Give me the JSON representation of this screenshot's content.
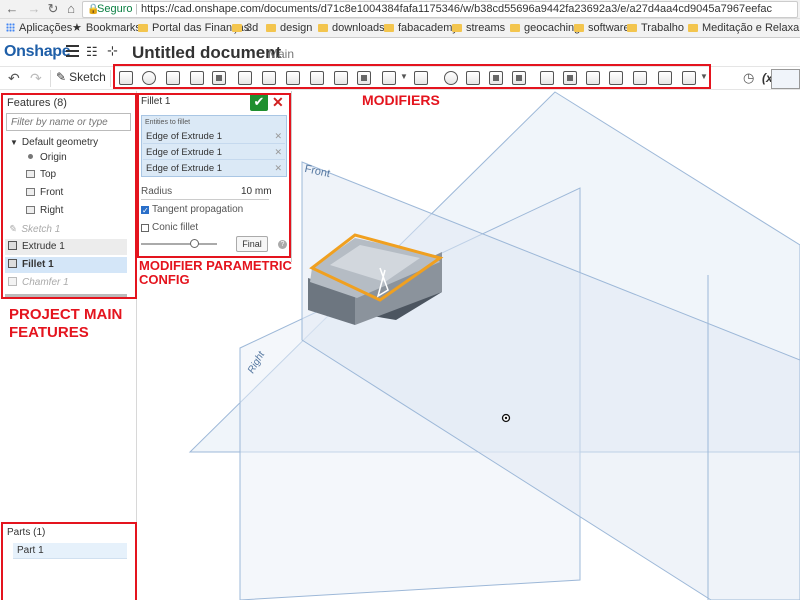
{
  "browser": {
    "secure_label": "Seguro",
    "url": "https://cad.onshape.com/documents/d71c8e1004384fafa1175346/w/b38cd55696a9442fa23692a3/e/a27d4aa4cd9045a7967eefac",
    "bookmarks": [
      "Aplicações",
      "Bookmarks",
      "Portal das Finanças",
      "3d",
      "design",
      "downloads",
      "fabacademy",
      "streams",
      "geocaching",
      "software",
      "Trabalho",
      "Meditação e Relaxam"
    ]
  },
  "app": {
    "logo": "Onshape",
    "document_title": "Untitled document",
    "workspace": "Main"
  },
  "toolbar": {
    "sketch_label": "Sketch",
    "variable_label": "(x)"
  },
  "features": {
    "title": "Features (8)",
    "filter_placeholder": "Filter by name or type",
    "default_geometry": "Default geometry",
    "origin": "Origin",
    "planes": [
      "Top",
      "Front",
      "Right"
    ],
    "items": [
      {
        "name": "Sketch 1",
        "state": "suppressed"
      },
      {
        "name": "Extrude 1",
        "state": "normal"
      },
      {
        "name": "Fillet 1",
        "state": "editing"
      },
      {
        "name": "Chamfer 1",
        "state": "rolled-back"
      }
    ]
  },
  "parts": {
    "title": "Parts (1)",
    "items": [
      "Part 1"
    ]
  },
  "fillet": {
    "title": "Fillet 1",
    "entities_label": "Entities to fillet",
    "entities": [
      "Edge of Extrude 1",
      "Edge of Extrude 1",
      "Edge of Extrude 1"
    ],
    "radius_label": "Radius",
    "radius_value": "10 mm",
    "tangent_label": "Tangent propagation",
    "tangent_checked": true,
    "conic_label": "Conic fillet",
    "conic_checked": false,
    "final_label": "Final",
    "help": "?"
  },
  "annotations": {
    "modifiers": "MODIFIERS",
    "modifier_config_1": "MODIFIER PARAMETRIC",
    "modifier_config_2": "CONFIG",
    "project_1": "PROJECT MAIN",
    "project_2": "FEATURES"
  },
  "viewport": {
    "plane_front": "Front",
    "plane_right": "Right",
    "edge_color": "#f0a020",
    "plane_color": "#9db8d8"
  },
  "colors": {
    "annotation": "#e4141e",
    "accept": "#1f8f2f",
    "brand": "#1f5fa8"
  }
}
